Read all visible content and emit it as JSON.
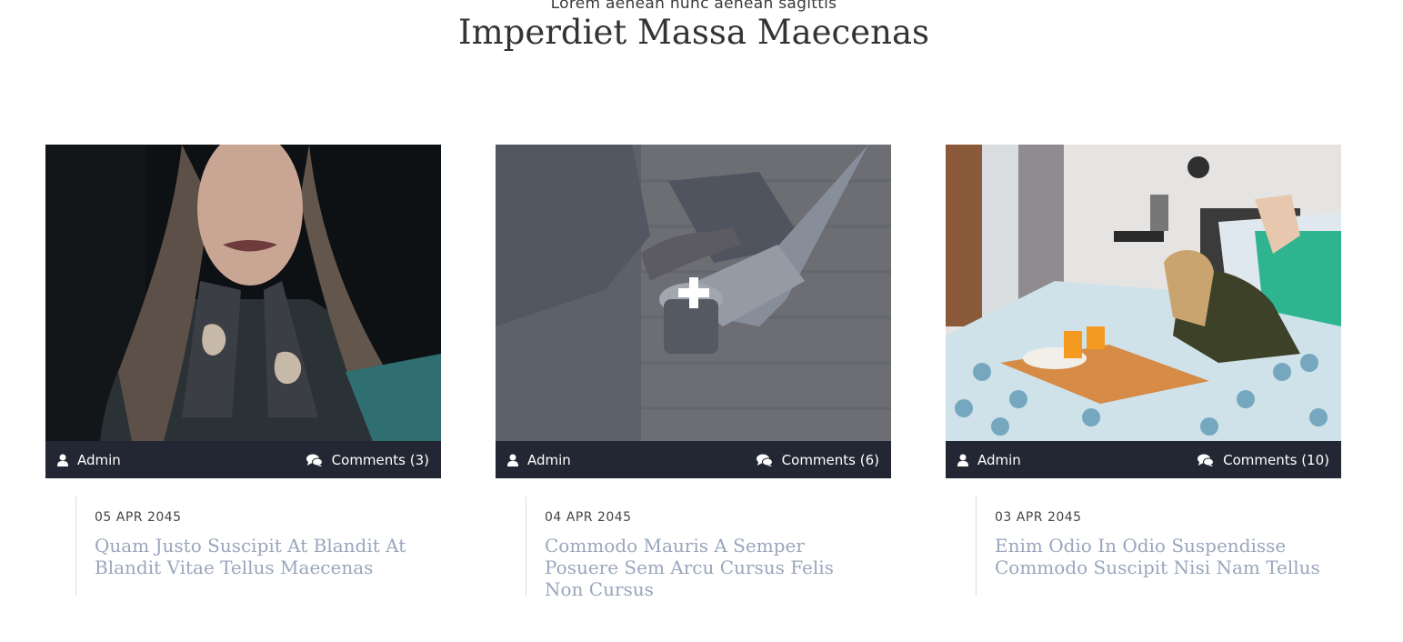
{
  "section": {
    "eyebrow": "Lorem aenean nunc aenean sagittis",
    "title": "Imperdiet Massa Maecenas"
  },
  "posts": [
    {
      "author": "Admin",
      "comments": "Comments (3)",
      "date": "05 APR 2045",
      "title": "Quam Justo Suscipit At Blandit At Blandit Vitae Tellus Maecenas",
      "image": "woman-tattoos-photo"
    },
    {
      "author": "Admin",
      "comments": "Comments (6)",
      "date": "04 APR 2045",
      "title": "Commodo Mauris A Semper Posuere Sem Arcu Cursus Felis Non Cursus",
      "image": "laptop-coffee-photo",
      "hover_overlay": true
    },
    {
      "author": "Admin",
      "comments": "Comments (10)",
      "date": "03 APR 2045",
      "title": "Enim Odio In Odio Suspendisse Commodo Suscipit Nisi Nam Tellus",
      "image": "woman-bed-breakfast-photo"
    }
  ],
  "icons": {
    "author": "user-icon",
    "comments": "comments-icon",
    "overlay": "plus-icon"
  },
  "colors": {
    "meta_bar": "#222733",
    "title_link": "#9aa6bc"
  }
}
